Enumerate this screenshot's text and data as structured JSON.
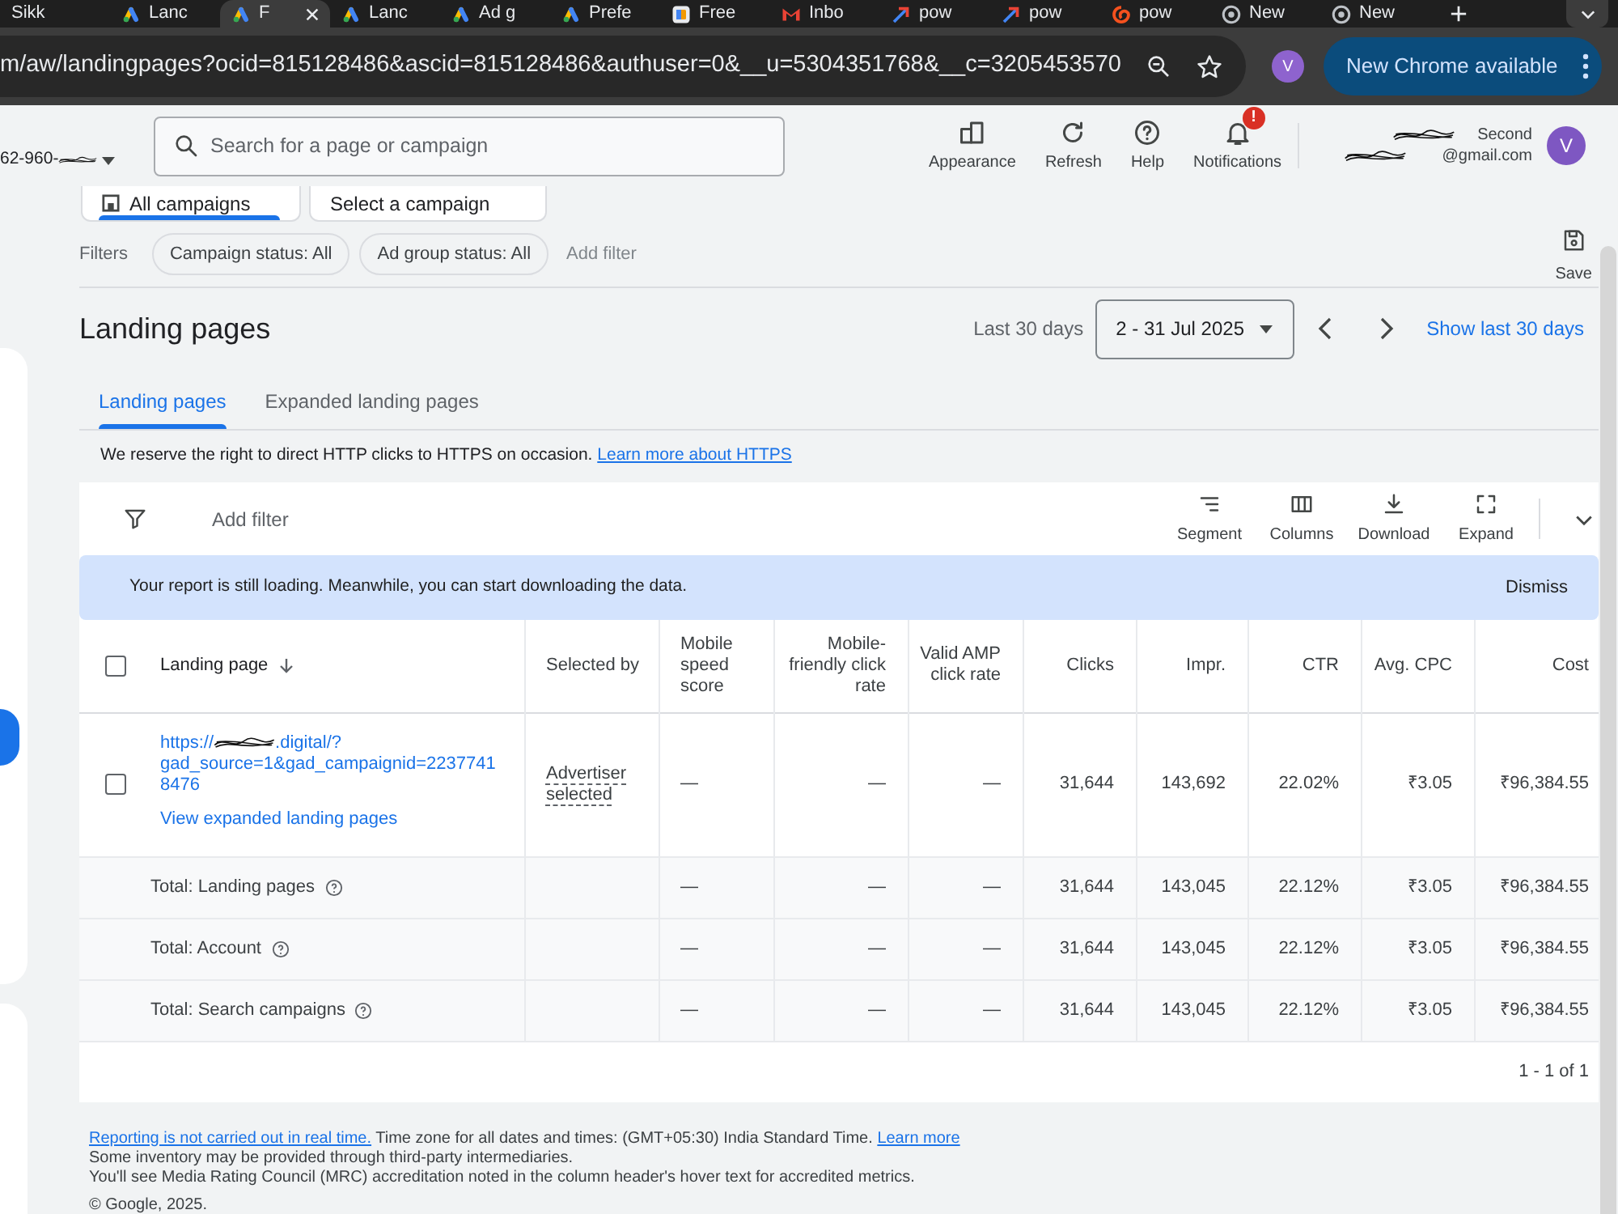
{
  "browser": {
    "tabs": [
      {
        "title": "Sikk",
        "kind": "none",
        "selected": false
      },
      {
        "title": "Lanc",
        "kind": "ads",
        "selected": false
      },
      {
        "title": "F",
        "kind": "ads",
        "selected": true
      },
      {
        "title": "Lanc",
        "kind": "ads",
        "selected": false
      },
      {
        "title": "Ad g",
        "kind": "ads",
        "selected": false
      },
      {
        "title": "Prefe",
        "kind": "ads",
        "selected": false
      },
      {
        "title": "Free",
        "kind": "doc",
        "selected": false
      },
      {
        "title": "Inbo",
        "kind": "mail",
        "selected": false
      },
      {
        "title": "pow",
        "kind": "arrow",
        "selected": false
      },
      {
        "title": "pow",
        "kind": "arrow",
        "selected": false
      },
      {
        "title": "pow",
        "kind": "swirl",
        "selected": false
      },
      {
        "title": "New",
        "kind": "globe",
        "selected": false
      },
      {
        "title": "New",
        "kind": "globe",
        "selected": false
      }
    ],
    "address": "m/aw/landingpages?ocid=815128486&ascid=815128486&authuser=0&__u=5304351768&__c=3205453570",
    "profile_initial": "V",
    "update_button": "New Chrome available"
  },
  "header": {
    "account": "62-960-",
    "search": {
      "placeholder": "Search for a page or campaign"
    },
    "actions": [
      {
        "label": "Appearance",
        "kind": "appearance"
      },
      {
        "label": "Refresh",
        "kind": "refresh"
      },
      {
        "label": "Help",
        "kind": "help"
      },
      {
        "label": "Notifications",
        "kind": "bell",
        "badge": "!"
      }
    ],
    "user": {
      "line_1": "Second",
      "line_2": "@gmail.com",
      "initial": "V"
    }
  },
  "scope": {
    "tabs": [
      {
        "label": "All campaigns",
        "selected": true
      },
      {
        "label": "Select a campaign",
        "selected": false
      }
    ]
  },
  "filters": {
    "label": "Filters",
    "chips": [
      "Campaign status: All",
      "Ad group status: All"
    ],
    "add_filter": "Add filter",
    "save": "Save"
  },
  "page": {
    "title": "Landing pages",
    "date_label": "Last 30 days",
    "date_range": "2 - 31 Jul 2025",
    "show_last": "Show last 30 days",
    "tabs": [
      {
        "label": "Landing pages",
        "selected": true
      },
      {
        "label": "Expanded landing pages",
        "selected": false
      }
    ],
    "notice": {
      "text": "We reserve the right to direct HTTP clicks to HTTPS on occasion.",
      "link": "Learn more about HTTPS"
    }
  },
  "table": {
    "add_filter": "Add filter",
    "tools": [
      {
        "label": "Segment",
        "kind": "segment"
      },
      {
        "label": "Columns",
        "kind": "columns"
      },
      {
        "label": "Download",
        "kind": "download"
      },
      {
        "label": "Expand",
        "kind": "expand"
      }
    ],
    "banner": {
      "text": "Your report is still loading. Meanwhile, you can start downloading the data.",
      "action": "Dismiss"
    },
    "all_checked": false,
    "columns": [
      {
        "label": "Landing page",
        "sorted": true
      },
      {
        "label": "Selected by",
        "sorted": false
      },
      {
        "label": "Mobile speed score",
        "sorted": false
      },
      {
        "label": "Mobile-friendly click rate",
        "sorted": false
      },
      {
        "label": "Valid AMP click rate",
        "sorted": false
      },
      {
        "label": "Clicks",
        "sorted": false
      },
      {
        "label": "Impr.",
        "sorted": false
      },
      {
        "label": "CTR",
        "sorted": false
      },
      {
        "label": "Avg. CPC",
        "sorted": false
      },
      {
        "label": "Cost",
        "sorted": false
      }
    ],
    "rows": [
      {
        "kind": "page",
        "checked": false,
        "cells": [
          {
            "url_start": "https://",
            "url_end": ".digital/?gad_source=1&gad_campaignid=22377418476",
            "sublink": "View expanded landing pages"
          },
          "Advertiser selected",
          "—",
          "—",
          "—",
          "31,644",
          "143,692",
          "22.02%",
          "₹3.05",
          "₹96,384.55"
        ]
      },
      {
        "kind": "total",
        "cells": [
          "Total: Landing pages",
          "",
          "—",
          "—",
          "—",
          "31,644",
          "143,045",
          "22.12%",
          "₹3.05",
          "₹96,384.55"
        ]
      },
      {
        "kind": "total",
        "cells": [
          "Total: Account",
          "",
          "—",
          "—",
          "—",
          "31,644",
          "143,045",
          "22.12%",
          "₹3.05",
          "₹96,384.55"
        ]
      },
      {
        "kind": "total",
        "cells": [
          "Total: Search campaigns",
          "",
          "—",
          "—",
          "—",
          "31,644",
          "143,045",
          "22.12%",
          "₹3.05",
          "₹96,384.55"
        ]
      }
    ],
    "pagination": "1 - 1 of 1"
  },
  "footer": {
    "realtime_link": "Reporting is not carried out in real time.",
    "timezone": "Time zone for all dates and times: (GMT+05:30) India Standard Time.",
    "learn_more": "Learn more",
    "lines": [
      "Some inventory may be provided through third-party intermediaries.",
      "You'll see Media Rating Council (MRC) accreditation noted in the column header's hover text for accredited metrics."
    ],
    "copyright": "© Google, 2025."
  }
}
